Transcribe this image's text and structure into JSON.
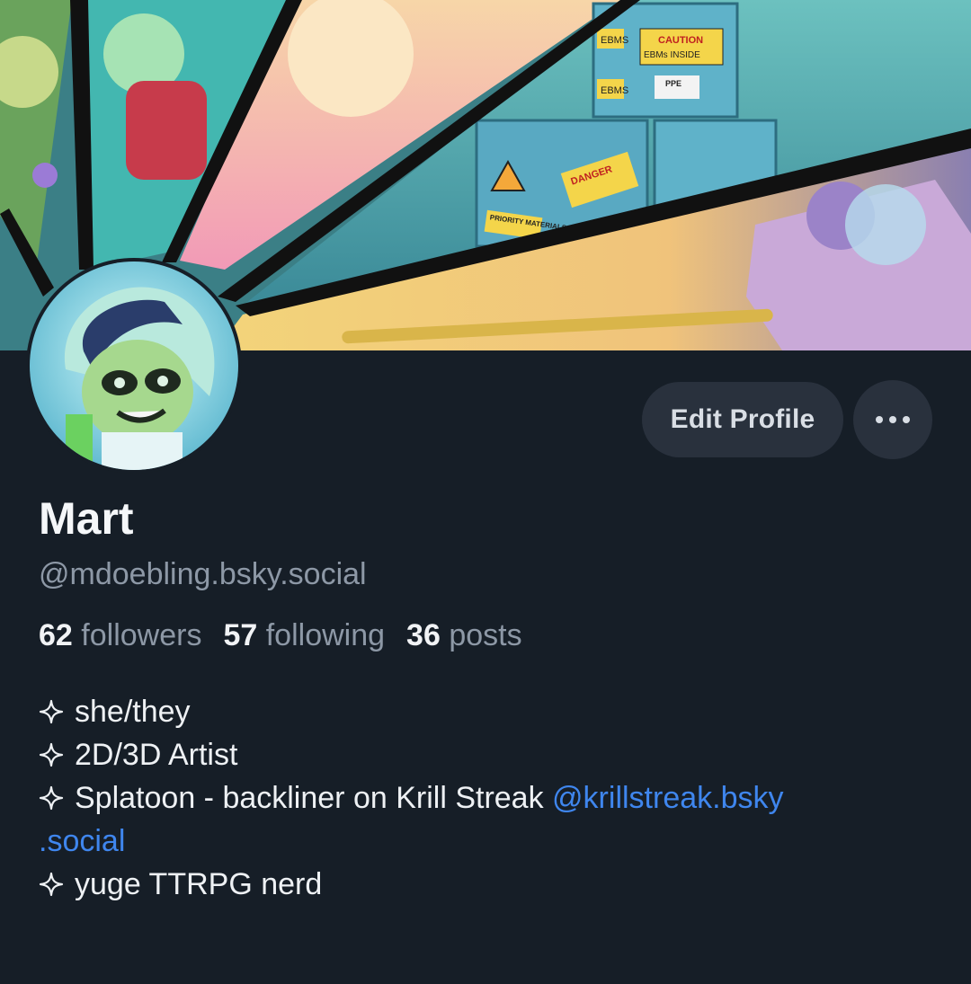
{
  "profile": {
    "display_name": "Mart",
    "handle": "@mdoebling.bsky.social",
    "avatar_alt": "avatar"
  },
  "stats": {
    "followers_count": "62",
    "followers_label": "followers",
    "following_count": "57",
    "following_label": "following",
    "posts_count": "36",
    "posts_label": "posts"
  },
  "actions": {
    "edit_profile_label": "Edit Profile",
    "more_icon": "ellipsis-icon"
  },
  "bio": {
    "bullet_icon": "sparkle-icon",
    "lines": [
      "she/they",
      "2D/3D Artist",
      "Splatoon - backliner on Krill Streak ",
      "yuge TTRPG nerd"
    ],
    "mention_part1": "@krillstreak.bsky",
    "mention_part2": ".social"
  },
  "banner": {
    "labels": {
      "ebms_1": "EBMS",
      "ebms_2": "EBMS",
      "caution": "CAUTION",
      "caution_sub": "EBMs INSIDE",
      "ppe": "PPE",
      "danger": "DANGER",
      "priority": "PRIORITY MATERIALS"
    }
  },
  "colors": {
    "background": "#161e27",
    "button_bg": "#29313d",
    "muted_text": "#8d98a6",
    "link": "#3f86ee"
  }
}
